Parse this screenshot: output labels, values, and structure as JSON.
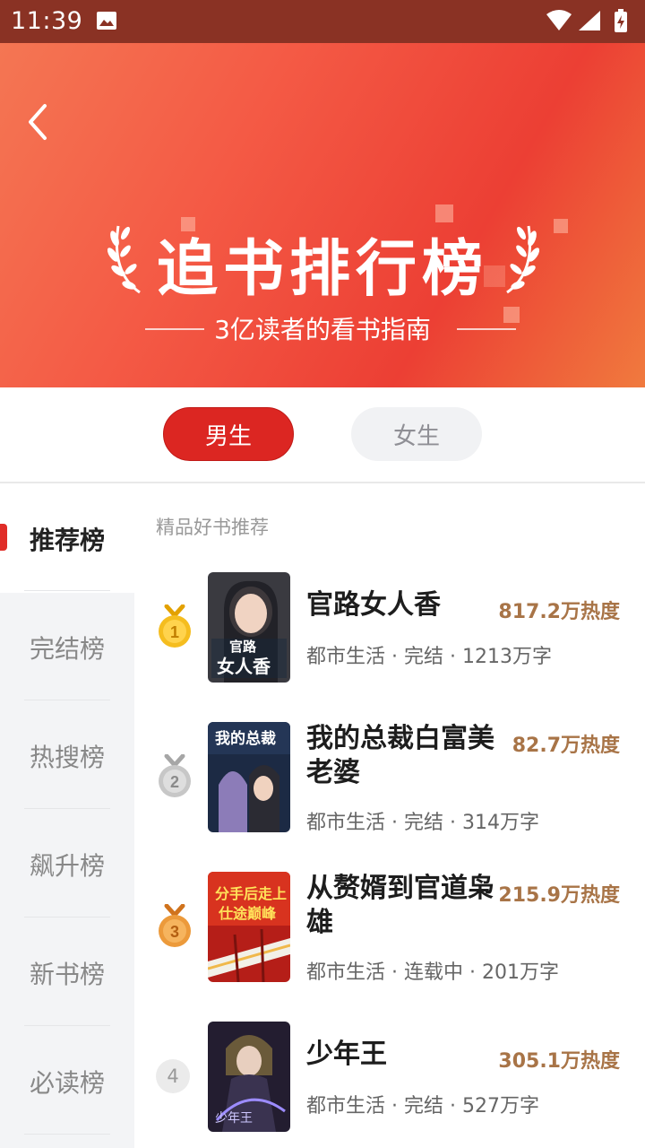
{
  "status": {
    "time": "11:39"
  },
  "banner": {
    "title": "追书排行榜",
    "subtitle": "3亿读者的看书指南"
  },
  "gender_tabs": {
    "male": "男生",
    "female": "女生",
    "selected": "男生"
  },
  "sidebar": {
    "items": [
      {
        "label": "推荐榜",
        "active": true
      },
      {
        "label": "完结榜",
        "active": false
      },
      {
        "label": "热搜榜",
        "active": false
      },
      {
        "label": "飙升榜",
        "active": false
      },
      {
        "label": "新书榜",
        "active": false
      },
      {
        "label": "必读榜",
        "active": false
      }
    ]
  },
  "list": {
    "section_label": "精品好书推荐",
    "books": [
      {
        "rank": "1",
        "title": "官路女人香",
        "heat": "817.2万热度",
        "meta": "都市生活 · 完结 · 1213万字",
        "cover_text": "官路女人香"
      },
      {
        "rank": "2",
        "title": "我的总裁白富美老婆",
        "title_line1": "我的总裁白富美",
        "title_line2": "老婆",
        "heat": "82.7万热度",
        "meta": "都市生活 · 完结 · 314万字",
        "cover_text": "我的总裁"
      },
      {
        "rank": "3",
        "title": "从赘婿到官道枭雄",
        "title_line1": "从赘婿到官道枭",
        "title_line2": "雄",
        "heat": "215.9万热度",
        "meta": "都市生活 · 连载中 · 201万字",
        "cover_text": "分手后走上仕途巅峰"
      },
      {
        "rank": "4",
        "title": "少年王",
        "heat": "305.1万热度",
        "meta": "都市生活 · 完结 · 527万字",
        "cover_text": "少年王"
      }
    ]
  },
  "colors": {
    "accent": "#dc2622",
    "heat": "#a87447",
    "status_bar": "#8a3224"
  }
}
